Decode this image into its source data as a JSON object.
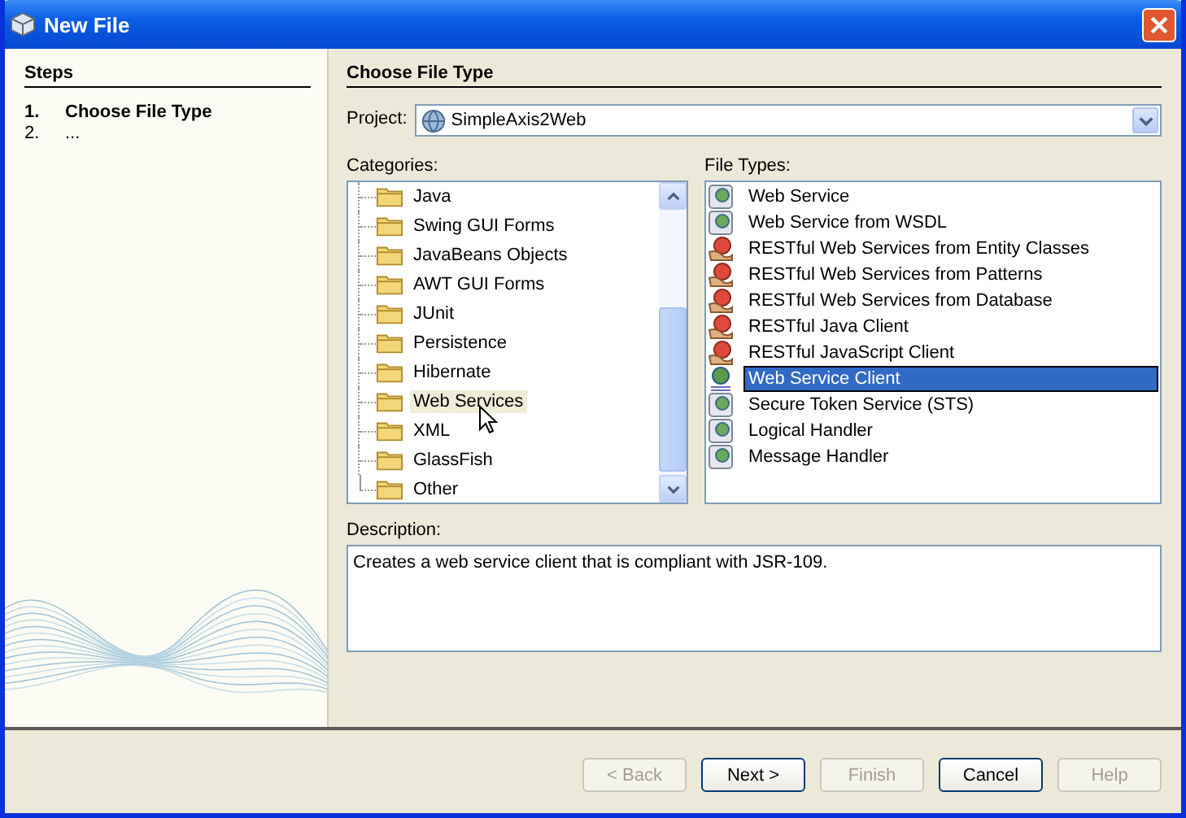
{
  "window": {
    "title": "New File"
  },
  "steps": {
    "title": "Steps",
    "items": [
      {
        "number": "1.",
        "label": "Choose File Type",
        "selected": true
      },
      {
        "number": "2.",
        "label": "...",
        "selected": false
      }
    ]
  },
  "panel": {
    "title": "Choose File Type",
    "project": {
      "label": "Project:",
      "value": "SimpleAxis2Web"
    },
    "categories": {
      "label": "Categories:",
      "items": [
        {
          "label": "Java",
          "selected": false
        },
        {
          "label": "Swing GUI Forms",
          "selected": false
        },
        {
          "label": "JavaBeans Objects",
          "selected": false
        },
        {
          "label": "AWT GUI Forms",
          "selected": false
        },
        {
          "label": "JUnit",
          "selected": false
        },
        {
          "label": "Persistence",
          "selected": false
        },
        {
          "label": "Hibernate",
          "selected": false
        },
        {
          "label": "Web Services",
          "selected": true
        },
        {
          "label": "XML",
          "selected": false
        },
        {
          "label": "GlassFish",
          "selected": false
        },
        {
          "label": "Other",
          "selected": false
        }
      ]
    },
    "file_types": {
      "label": "File Types:",
      "items": [
        {
          "label": "Web Service",
          "kind": "service",
          "selected": false
        },
        {
          "label": "Web Service from WSDL",
          "kind": "service",
          "selected": false
        },
        {
          "label": "RESTful Web Services from Entity Classes",
          "kind": "restful",
          "selected": false
        },
        {
          "label": "RESTful Web Services from Patterns",
          "kind": "restful",
          "selected": false
        },
        {
          "label": "RESTful Web Services from Database",
          "kind": "restful",
          "selected": false
        },
        {
          "label": "RESTful Java Client",
          "kind": "restful",
          "selected": false
        },
        {
          "label": "RESTful JavaScript Client",
          "kind": "restful",
          "selected": false
        },
        {
          "label": "Web Service Client",
          "kind": "client",
          "selected": true
        },
        {
          "label": "Secure Token Service (STS)",
          "kind": "service",
          "selected": false
        },
        {
          "label": "Logical Handler",
          "kind": "service",
          "selected": false
        },
        {
          "label": "Message Handler",
          "kind": "service",
          "selected": false
        }
      ]
    },
    "description": {
      "label": "Description:",
      "text": "Creates a web service client that is compliant with JSR-109."
    }
  },
  "buttons": [
    {
      "label": "< Back",
      "disabled": true
    },
    {
      "label": "Next >",
      "disabled": false
    },
    {
      "label": "Finish",
      "disabled": true
    },
    {
      "label": "Cancel",
      "disabled": false
    },
    {
      "label": "Help",
      "disabled": true
    }
  ]
}
